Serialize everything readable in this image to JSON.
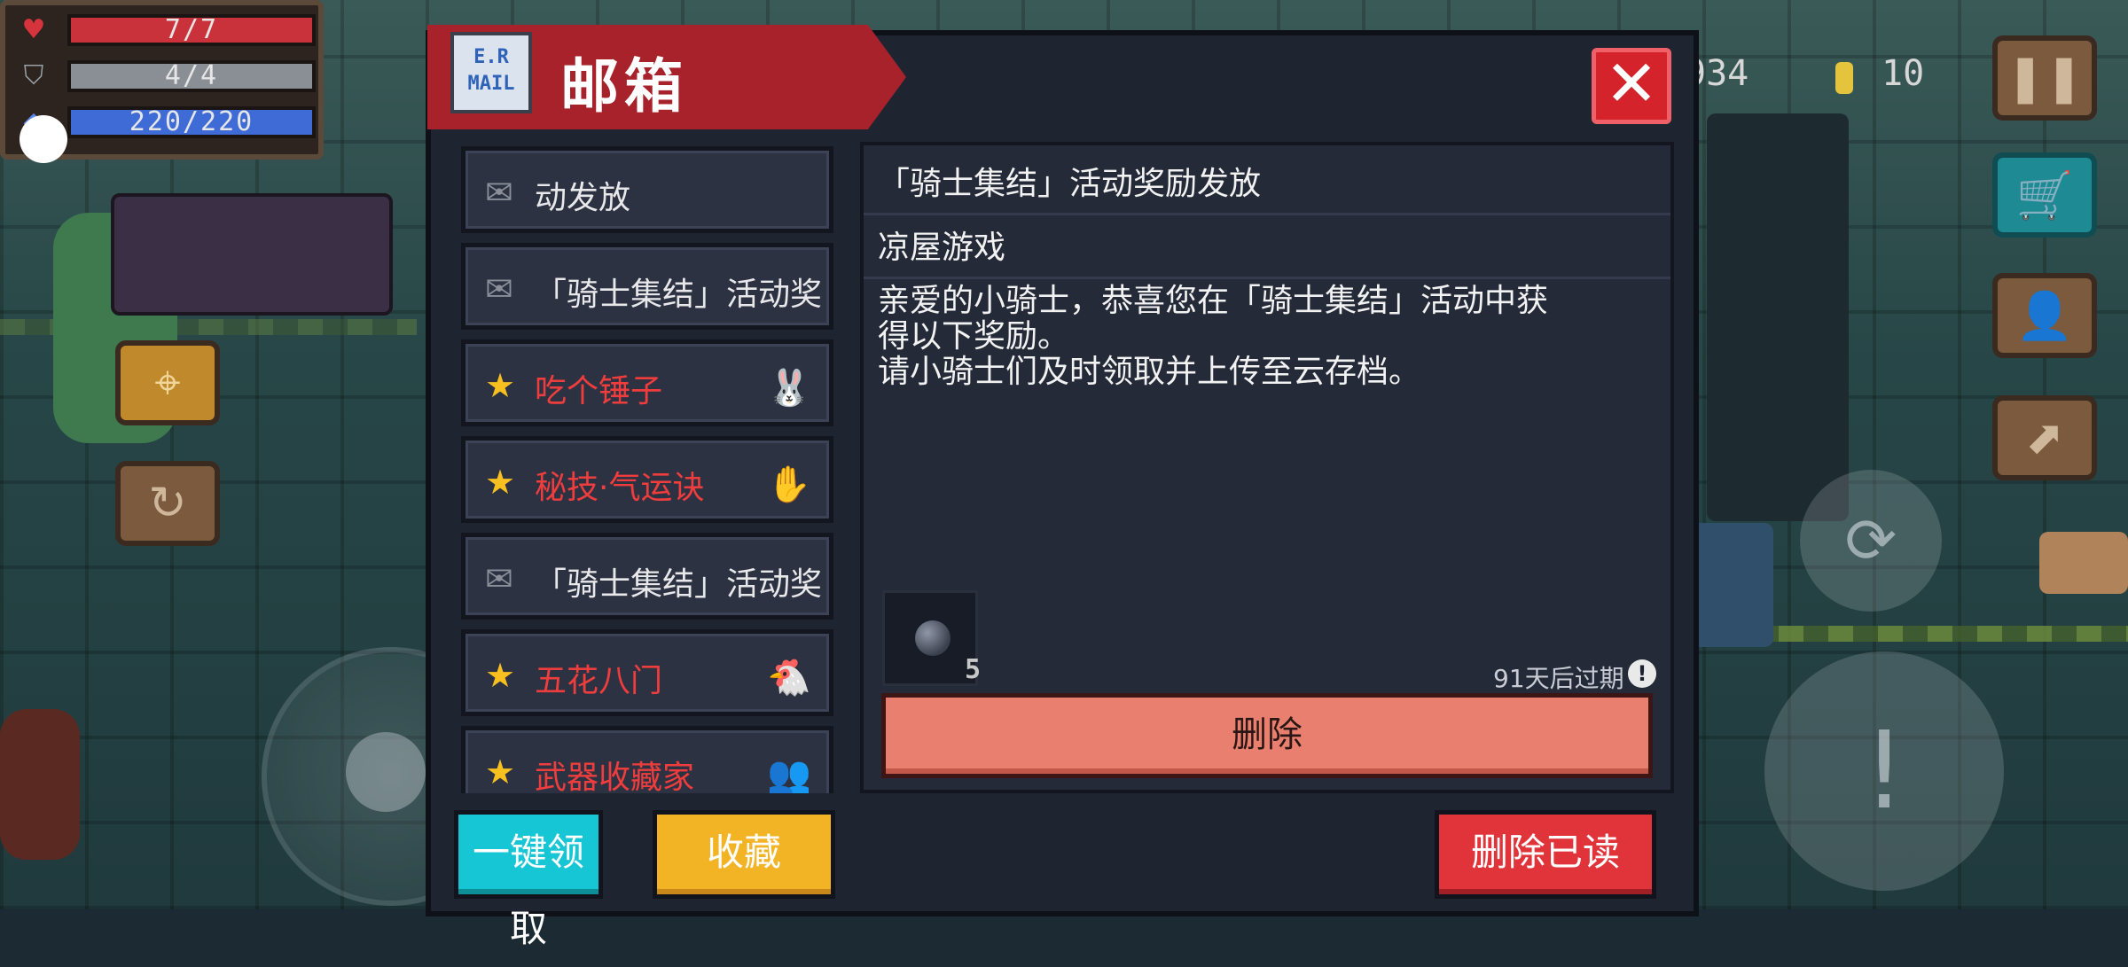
{
  "hud": {
    "hp": "7/7",
    "armor": "4/4",
    "energy": "220/220",
    "coins": "934",
    "gold": "10"
  },
  "mailbox": {
    "header_icon_text": "E.R MAIL",
    "title": "邮箱",
    "close_glyph": "✕",
    "list": [
      {
        "label": "动发放",
        "type": "read",
        "icon": "✉",
        "thumb": ""
      },
      {
        "label": "「骑士集结」活动奖",
        "type": "read",
        "icon": "✉",
        "thumb": ""
      },
      {
        "label": "吃个锤子",
        "type": "starred",
        "icon": "★",
        "thumb": "🐰"
      },
      {
        "label": "秘技·气运诀",
        "type": "starred",
        "icon": "★",
        "thumb": "✋"
      },
      {
        "label": "「骑士集结」活动奖",
        "type": "read",
        "icon": "✉",
        "thumb": ""
      },
      {
        "label": "五花八门",
        "type": "starred",
        "icon": "★",
        "thumb": "🐔"
      },
      {
        "label": "武器收藏家",
        "type": "starred",
        "icon": "★",
        "thumb": "👥"
      }
    ],
    "detail": {
      "title": "「骑士集结」活动奖励发放",
      "sender": "凉屋游戏",
      "body": "亲爱的小骑士，恭喜您在「骑士集结」活动中获\n得以下奖励。\n请小骑士们及时领取并上传至云存档。",
      "attachment_count": "5",
      "expiry": "91天后过期",
      "expiry_icon": "!",
      "delete_label": "删除"
    },
    "buttons": {
      "claim_all": "一键领取",
      "favorite": "收藏",
      "delete_read": "删除已读"
    }
  },
  "colors": {
    "header_red": "#a8222b",
    "close_red": "#d4232b",
    "starred_text": "#ef3d3d",
    "claim_cyan": "#17c6d4",
    "favorite_yellow": "#f2b325",
    "delete_salmon": "#e9806f"
  }
}
